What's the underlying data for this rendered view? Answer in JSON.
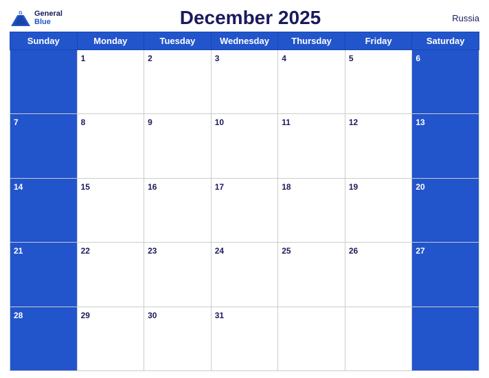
{
  "header": {
    "title": "December 2025",
    "country": "Russia",
    "logo_general": "General",
    "logo_blue": "Blue"
  },
  "weekdays": [
    "Sunday",
    "Monday",
    "Tuesday",
    "Wednesday",
    "Thursday",
    "Friday",
    "Saturday"
  ],
  "weeks": [
    [
      null,
      1,
      2,
      3,
      4,
      5,
      6
    ],
    [
      7,
      8,
      9,
      10,
      11,
      12,
      13
    ],
    [
      14,
      15,
      16,
      17,
      18,
      19,
      20
    ],
    [
      21,
      22,
      23,
      24,
      25,
      26,
      27
    ],
    [
      28,
      29,
      30,
      31,
      null,
      null,
      null
    ]
  ]
}
